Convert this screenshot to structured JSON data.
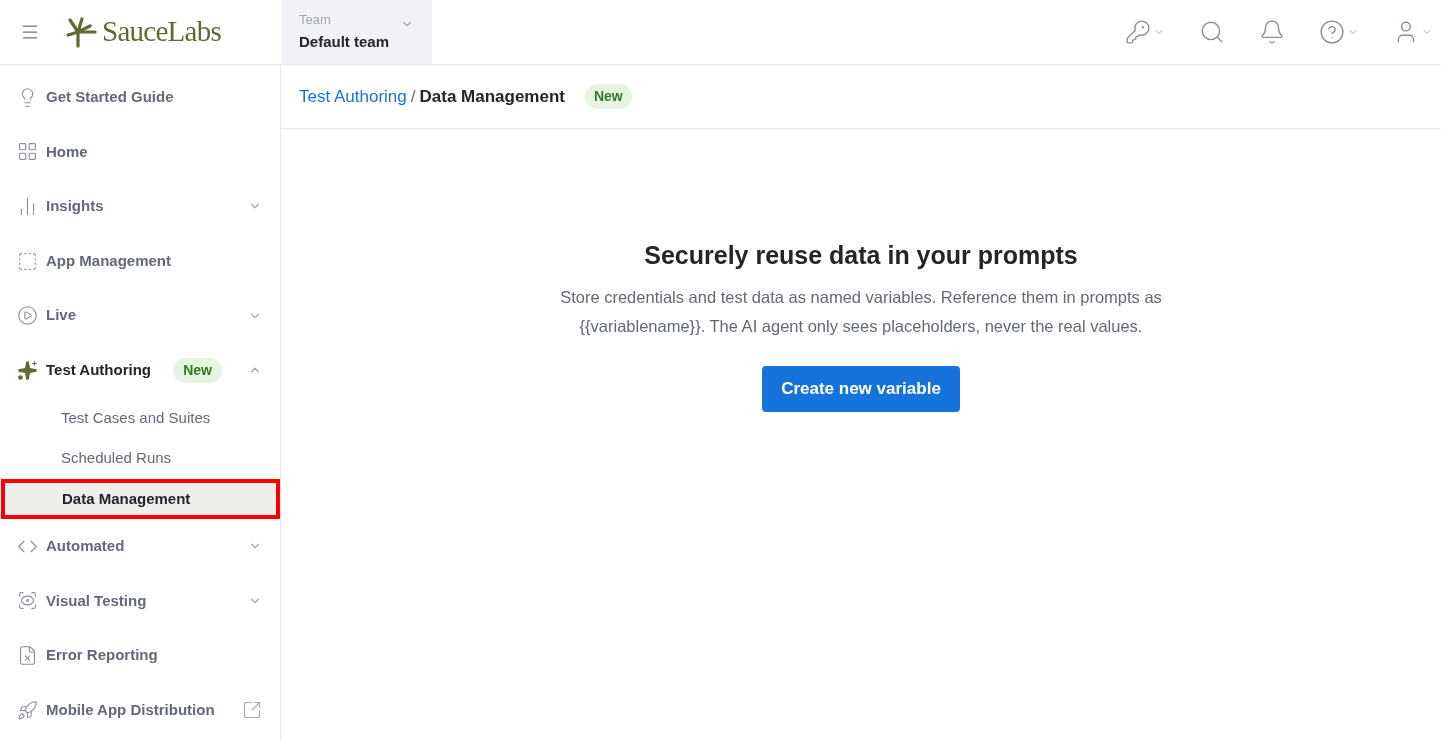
{
  "header": {
    "logo": "SauceLabs",
    "team": {
      "label": "Team",
      "value": "Default team"
    }
  },
  "sidebar": {
    "items": [
      {
        "label": "Get Started Guide",
        "kind": "link"
      },
      {
        "label": "Home",
        "kind": "link"
      },
      {
        "label": "Insights",
        "kind": "group",
        "expanded": false
      },
      {
        "label": "App Management",
        "kind": "link"
      },
      {
        "label": "Live",
        "kind": "group",
        "expanded": false
      },
      {
        "label": "Test Authoring",
        "kind": "group",
        "expanded": true,
        "badge": "New",
        "children": [
          {
            "label": "Test Cases and Suites",
            "selected": false,
            "highlighted": false
          },
          {
            "label": "Scheduled Runs",
            "selected": false,
            "highlighted": false
          },
          {
            "label": "Data Management",
            "selected": true,
            "highlighted": true
          }
        ]
      },
      {
        "label": "Automated",
        "kind": "group",
        "expanded": false
      },
      {
        "label": "Visual Testing",
        "kind": "group",
        "expanded": false
      },
      {
        "label": "Error Reporting",
        "kind": "link"
      },
      {
        "label": "Mobile App Distribution",
        "kind": "external"
      }
    ]
  },
  "breadcrumb": {
    "parent": "Test Authoring",
    "separator": "/",
    "current": "Data Management",
    "badge": "New"
  },
  "empty_state": {
    "title": "Securely reuse data in your prompts",
    "description": "Store credentials and test data as named variables. Reference them in prompts as {{variablename}}. The AI agent only sees placeholders, never the real values.",
    "button": "Create new variable"
  }
}
